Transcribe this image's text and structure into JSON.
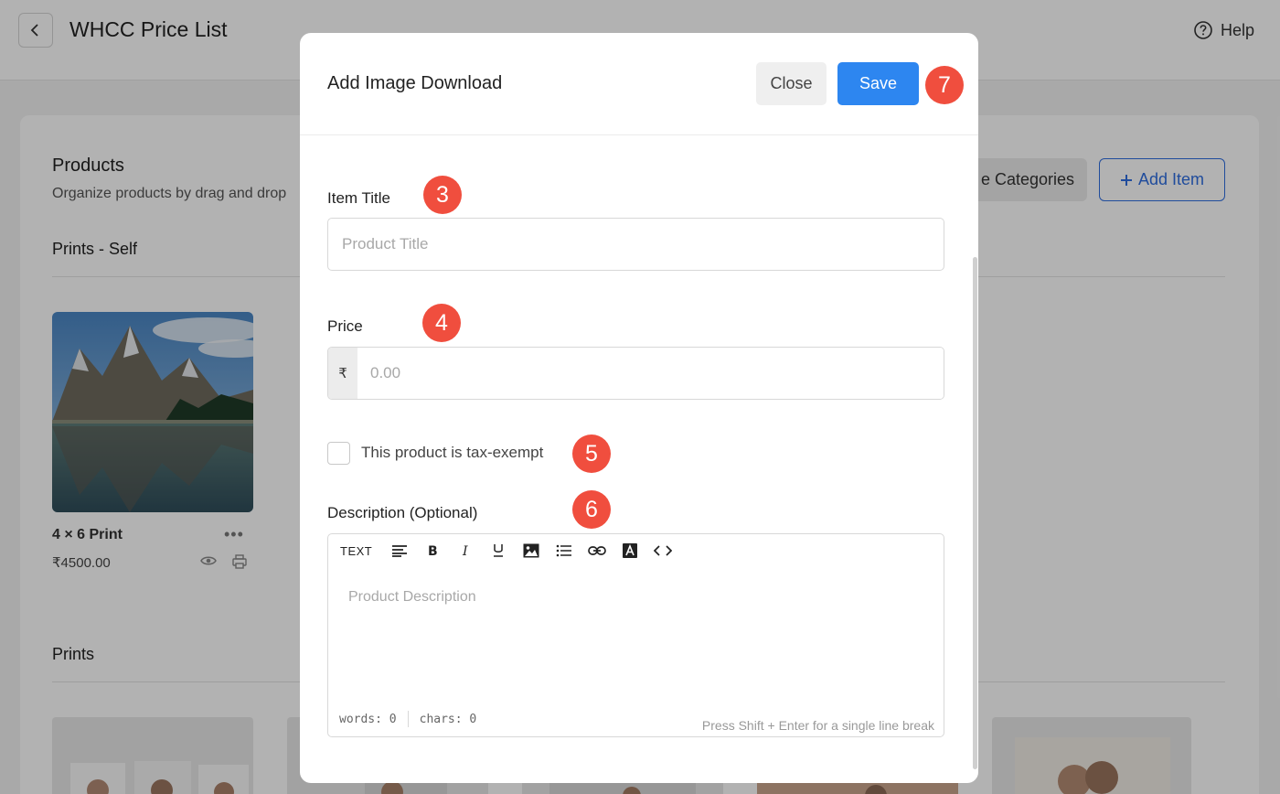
{
  "app": {
    "page_title": "WHCC Price List",
    "help_label": "Help"
  },
  "background": {
    "products_title": "Products",
    "products_subtitle": "Organize products by drag and drop",
    "manage_categories_label": "Manage Categories",
    "manage_categories_visible": "e Categories",
    "add_item_label": "Add Item",
    "section_1": "Prints - Self",
    "product": {
      "name": "4 × 6 Print",
      "price": "₹4500.00"
    },
    "section_2": "Prints"
  },
  "modal": {
    "title": "Add Image Download",
    "close_label": "Close",
    "save_label": "Save",
    "item_title": {
      "label": "Item Title",
      "placeholder": "Product Title",
      "value": ""
    },
    "price": {
      "label": "Price",
      "currency": "₹",
      "placeholder": "0.00",
      "value": ""
    },
    "tax_exempt": {
      "label": "This product is tax-exempt",
      "checked": false
    },
    "description": {
      "label": "Description (Optional)",
      "placeholder": "Product Description",
      "toolbar": {
        "text_label": "TEXT",
        "icons": [
          "align-left-icon",
          "bold-icon",
          "italic-icon",
          "underline-icon",
          "image-icon",
          "list-icon",
          "link-icon",
          "text-color-icon",
          "code-icon"
        ]
      },
      "words": "words: 0",
      "chars": "chars: 0",
      "hint": "Press Shift + Enter for a single line break"
    }
  },
  "badges": [
    "3",
    "4",
    "5",
    "6",
    "7"
  ],
  "colors": {
    "primary": "#2d86f0",
    "badge": "#f04e3e",
    "add_item_border": "#2f6ee0"
  }
}
